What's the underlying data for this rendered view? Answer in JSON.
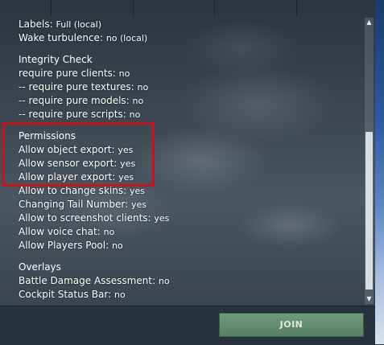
{
  "info": {
    "visual": {
      "labels": {
        "label": "Labels:",
        "value": "Full (local)"
      },
      "wake": {
        "label": "Wake turbulence:",
        "value": "no (local)"
      }
    },
    "integrity": {
      "title": "Integrity Check",
      "clients": {
        "label": "require pure clients:",
        "value": "no"
      },
      "textures": {
        "label": "-- require pure textures:",
        "value": "no"
      },
      "models": {
        "label": "-- require pure models:",
        "value": "no"
      },
      "scripts": {
        "label": "-- require pure scripts:",
        "value": "no"
      }
    },
    "permissions": {
      "title": "Permissions",
      "object_export": {
        "label": "Allow object export:",
        "value": "yes"
      },
      "sensor_export": {
        "label": "Allow sensor export:",
        "value": "yes"
      },
      "player_export": {
        "label": "Allow player export:",
        "value": "yes"
      },
      "change_skins": {
        "label": "Allow to change skins:",
        "value": "yes"
      },
      "tail_number": {
        "label": "Changing Tail Number:",
        "value": "yes"
      },
      "screenshot": {
        "label": "Allow to screenshot clients:",
        "value": "yes"
      },
      "voice_chat": {
        "label": "Allow voice chat:",
        "value": "no"
      },
      "players_pool": {
        "label": "Allow Players Pool:",
        "value": "no"
      }
    },
    "overlays": {
      "title": "Overlays",
      "bda": {
        "label": "Battle Damage Assessment:",
        "value": "no"
      },
      "cockpit_bar": {
        "label": "Cockpit Status Bar:",
        "value": "no"
      }
    }
  },
  "scroll": {
    "up": "▲",
    "down": "▼"
  },
  "footer": {
    "join_label": "JOIN"
  },
  "colors": {
    "highlight": "#c4151c",
    "join": "#6f9b7c"
  }
}
